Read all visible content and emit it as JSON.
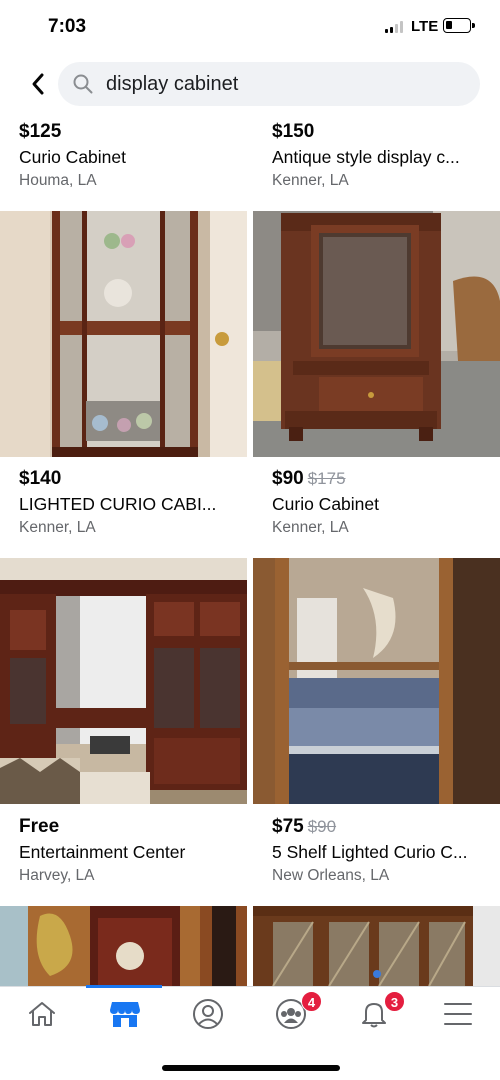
{
  "status_bar": {
    "time": "7:03",
    "network": "LTE"
  },
  "search": {
    "query": "display cabinet",
    "back_icon": "chevron-left-icon",
    "search_icon": "magnifier-icon"
  },
  "listings": [
    {
      "price": "$125",
      "old_price": "",
      "title": "Curio Cabinet",
      "location": "Houma, LA"
    },
    {
      "price": "$150",
      "old_price": "",
      "title": "Antique style display c...",
      "location": "Kenner, LA"
    },
    {
      "price": "$140",
      "old_price": "",
      "title": "LIGHTED CURIO CABI...",
      "location": "Kenner, LA"
    },
    {
      "price": "$90",
      "old_price": "$175",
      "title": "Curio Cabinet",
      "location": "Kenner, LA"
    },
    {
      "price": "Free",
      "old_price": "",
      "title": "Entertainment Center",
      "location": "Harvey, LA"
    },
    {
      "price": "$75",
      "old_price": "$90",
      "title": "5 Shelf Lighted Curio C...",
      "location": "New Orleans, LA"
    }
  ],
  "tab_bar": {
    "tabs": [
      {
        "icon": "home-icon",
        "active": false
      },
      {
        "icon": "marketplace-icon",
        "active": true
      },
      {
        "icon": "profile-icon",
        "active": false
      },
      {
        "icon": "groups-icon",
        "active": false,
        "badge": "4"
      },
      {
        "icon": "bell-icon",
        "active": false,
        "badge": "3"
      },
      {
        "icon": "menu-icon",
        "active": false
      }
    ]
  },
  "colors": {
    "accent": "#1877f2",
    "badge": "#e41e3f",
    "search_bg": "#f0f2f5",
    "secondary_text": "#65676b"
  }
}
